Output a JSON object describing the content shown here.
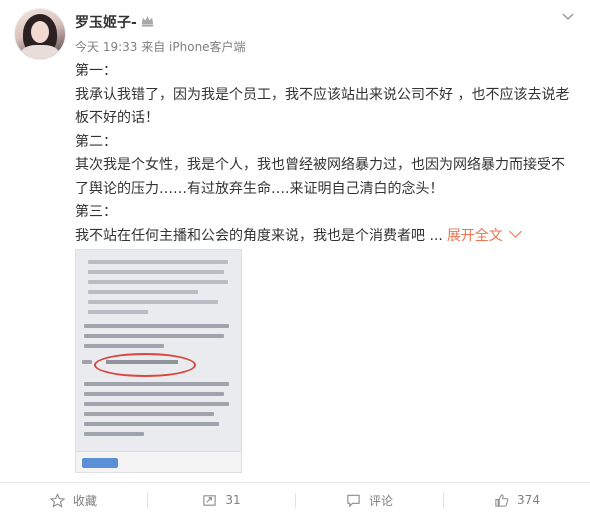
{
  "post": {
    "username": "罗玉姬子-",
    "time": "今天 19:33",
    "source": "来自 iPhone客户端",
    "lines": [
      "第一：",
      "我承认我错了，因为我是个员工，我不应该站出来说公司不好 ，也不应该去说老板不好的话！",
      "第二：",
      "其次我是个女性，我是个人，我也曾经被网络暴力过，也因为网络暴力而接受不了舆论的压力……有过放弃生命….来证明自己清白的念头！",
      "第三："
    ],
    "last_line": "我不站在任何主播和公会的角度来说，我也是个消费者吧 ...",
    "expand_label": "展开全文"
  },
  "image": {
    "icon": "law-document-screenshot",
    "circled_text": "《中华人民共和国刑法》",
    "year_text": "1997年"
  },
  "actions": {
    "favorite_label": "收藏",
    "repost_count": "31",
    "comment_label": "评论",
    "like_count": "374"
  },
  "colors": {
    "accent": "#eb7350",
    "text": "#333333",
    "meta": "#808080",
    "vip": "#999999"
  }
}
